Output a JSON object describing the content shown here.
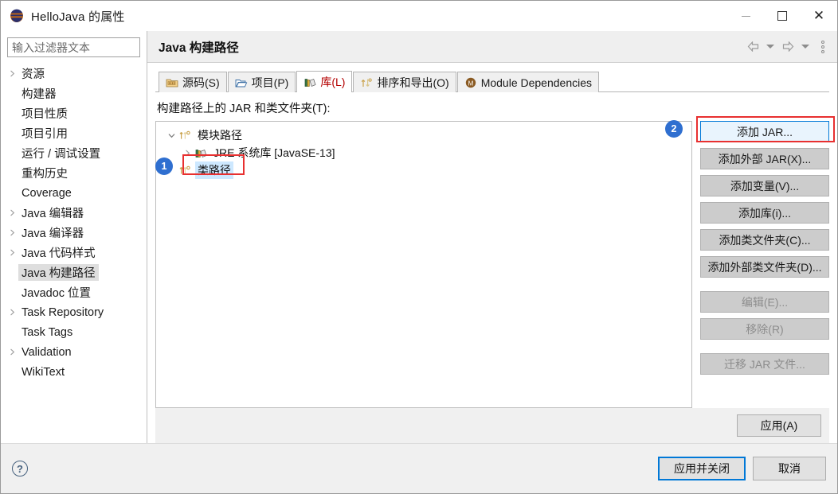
{
  "window": {
    "title": "HelloJava 的属性",
    "app_icon": "eclipse-sphere-icon",
    "minimize_label": "最小化",
    "maximize_label": "最大化",
    "close_label": "关闭"
  },
  "sidebar": {
    "filter": {
      "value": "",
      "placeholder": "输入过滤器文本"
    },
    "items": [
      {
        "label": "资源",
        "expandable": true,
        "selected": false
      },
      {
        "label": "构建器",
        "expandable": false,
        "selected": false
      },
      {
        "label": "项目性质",
        "expandable": false,
        "selected": false
      },
      {
        "label": "项目引用",
        "expandable": false,
        "selected": false
      },
      {
        "label": "运行 / 调试设置",
        "expandable": false,
        "selected": false
      },
      {
        "label": "重构历史",
        "expandable": false,
        "selected": false
      },
      {
        "label": "Coverage",
        "expandable": false,
        "selected": false
      },
      {
        "label": "Java 编辑器",
        "expandable": true,
        "selected": false
      },
      {
        "label": "Java 编译器",
        "expandable": true,
        "selected": false
      },
      {
        "label": "Java 代码样式",
        "expandable": true,
        "selected": false
      },
      {
        "label": "Java 构建路径",
        "expandable": false,
        "selected": true
      },
      {
        "label": "Javadoc 位置",
        "expandable": false,
        "selected": false
      },
      {
        "label": "Task Repository",
        "expandable": true,
        "selected": false
      },
      {
        "label": "Task Tags",
        "expandable": false,
        "selected": false
      },
      {
        "label": "Validation",
        "expandable": true,
        "selected": false
      },
      {
        "label": "WikiText",
        "expandable": false,
        "selected": false
      }
    ]
  },
  "page": {
    "title": "Java 构建路径",
    "nav": {
      "back": "back-arrow-icon",
      "back_menu": "chevron-down-icon",
      "forward": "forward-arrow-icon",
      "forward_menu": "chevron-down-icon",
      "more": "view-menu-icon"
    },
    "tabs": [
      {
        "label": "源码(S)",
        "icon": "source-folder-icon",
        "active": false
      },
      {
        "label": "项目(P)",
        "icon": "open-folder-icon",
        "active": false
      },
      {
        "label": "库(L)",
        "icon": "library-books-icon",
        "active": true
      },
      {
        "label": "排序和导出(O)",
        "icon": "order-export-icon",
        "active": false
      },
      {
        "label": "Module Dependencies",
        "icon": "module-icon",
        "active": false
      }
    ],
    "section_label": "构建路径上的 JAR 和类文件夹(T):",
    "tree": [
      {
        "label": "模块路径",
        "icon": "module-path-icon",
        "indent": 0,
        "twisty": "expanded",
        "selected": false
      },
      {
        "label": "JRE 系统库 [JavaSE-13]",
        "icon": "library-books-icon",
        "indent": 1,
        "twisty": "collapsed",
        "selected": false
      },
      {
        "label": "类路径",
        "icon": "module-path-icon",
        "indent": 0,
        "twisty": "none",
        "selected": true
      }
    ],
    "buttons": [
      {
        "label": "添加 JAR...",
        "state": "focused"
      },
      {
        "label": "添加外部 JAR(X)...",
        "state": "normal"
      },
      {
        "label": "添加变量(V)...",
        "state": "normal"
      },
      {
        "label": "添加库(i)...",
        "state": "normal"
      },
      {
        "label": "添加类文件夹(C)...",
        "state": "normal"
      },
      {
        "label": "添加外部类文件夹(D)...",
        "state": "normal"
      },
      {
        "label": "编辑(E)...",
        "state": "disabled",
        "gap": true
      },
      {
        "label": "移除(R)",
        "state": "disabled"
      },
      {
        "label": "迁移 JAR 文件...",
        "state": "disabled",
        "gap": true
      }
    ],
    "apply_label": "应用(A)"
  },
  "footer": {
    "help_icon": "help-question-icon",
    "apply_and_close": "应用并关闭",
    "cancel": "取消"
  },
  "annotations": [
    {
      "number": "1",
      "target": "classpath-tree-row"
    },
    {
      "number": "2",
      "target": "add-jar-button"
    }
  ],
  "colors": {
    "accent_blue": "#0078d7",
    "annotation_red": "#e83030",
    "annotation_badge": "#2f6fd0",
    "active_tab_text": "#b40000",
    "selection_blue": "#cde8ff"
  }
}
